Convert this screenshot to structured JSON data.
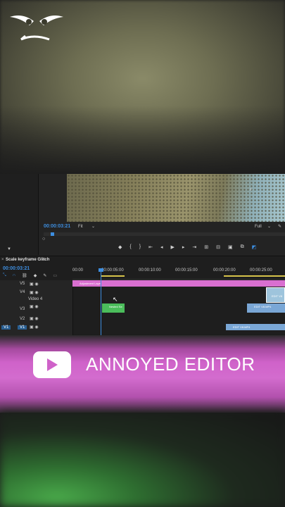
{
  "banner": {
    "title": "ANNOYED EDITOR"
  },
  "program": {
    "timecode": "00:00:03:21",
    "fit": "Fit",
    "resolution": "Full"
  },
  "sequence": {
    "tab": "Scale keyframe Glitch",
    "timecode": "00:00:03:21",
    "ruler": [
      "00:00",
      "00:00:05:00",
      "00:00:10:00",
      "00:00:15:00",
      "00:00:20:00",
      "00:00:25:00"
    ]
  },
  "tracks": {
    "v5": "V5",
    "v4": "V4",
    "video4": "Video 4",
    "v3": "V3",
    "v2": "V2",
    "v1": "V1",
    "v1_source": "V1"
  },
  "clips": {
    "adjustment": "Adjustment Layer",
    "nested": "Nested Se",
    "edit_v8": "EDIT V8.MP4",
    "edit_v8_2": "EDIT V8.MP4",
    "edit_v8_3": "EDIT V8"
  },
  "colors": {
    "accent": "#3d8ee0",
    "banner": "#cf62c9"
  }
}
